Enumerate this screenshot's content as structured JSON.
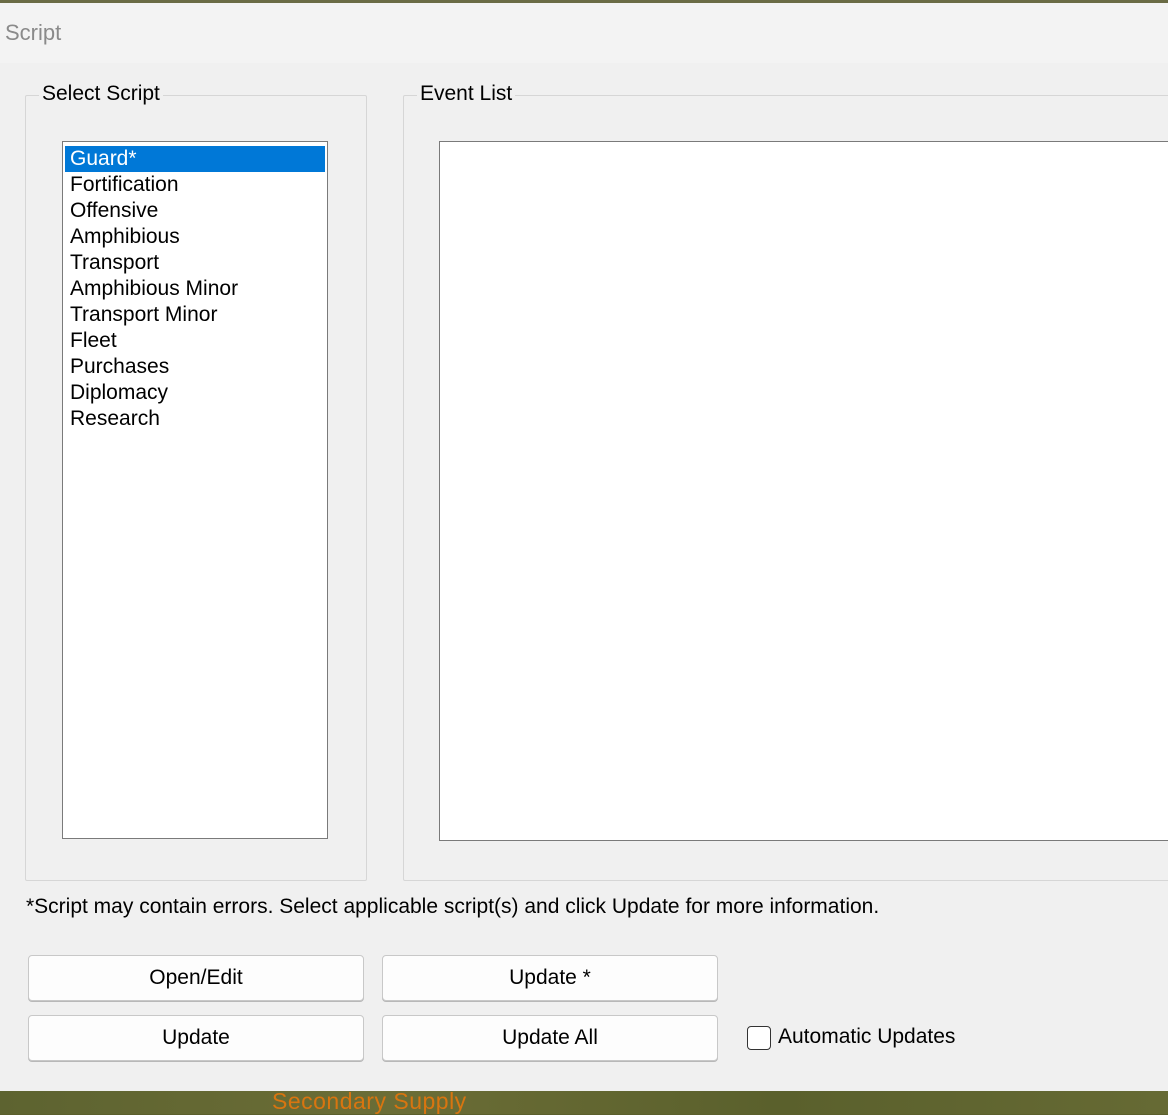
{
  "window": {
    "title": "Script"
  },
  "select_script": {
    "legend": "Select Script",
    "items": [
      {
        "label": "Guard*",
        "selected": true
      },
      {
        "label": "Fortification",
        "selected": false
      },
      {
        "label": "Offensive",
        "selected": false
      },
      {
        "label": "Amphibious",
        "selected": false
      },
      {
        "label": "Transport",
        "selected": false
      },
      {
        "label": "Amphibious Minor",
        "selected": false
      },
      {
        "label": "Transport Minor",
        "selected": false
      },
      {
        "label": "Fleet",
        "selected": false
      },
      {
        "label": "Purchases",
        "selected": false
      },
      {
        "label": "Diplomacy",
        "selected": false
      },
      {
        "label": "Research",
        "selected": false
      }
    ]
  },
  "event_list": {
    "legend": "Event List",
    "items": []
  },
  "note": "*Script may contain errors.  Select applicable script(s) and click Update for more information.",
  "buttons": {
    "open_edit": "Open/Edit",
    "update_star": "Update *",
    "update": "Update",
    "update_all": "Update All"
  },
  "automatic_updates": {
    "label": "Automatic Updates",
    "checked": false
  },
  "background": {
    "map_label": "Secondary Supply"
  },
  "colors": {
    "selection": "#0078d7",
    "map_label": "#d87510"
  }
}
